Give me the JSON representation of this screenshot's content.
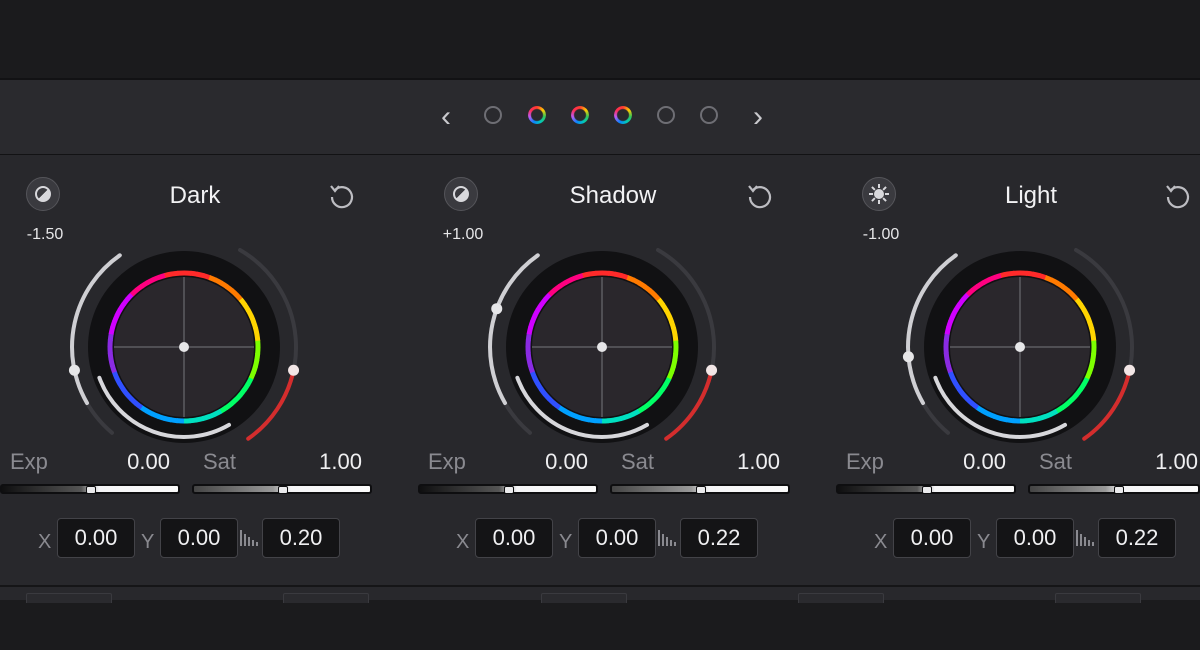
{
  "navigation": {
    "prev_icon": "chevron-left-icon",
    "next_icon": "chevron-right-icon",
    "pages": [
      {
        "state": "inactive"
      },
      {
        "state": "active"
      },
      {
        "state": "active"
      },
      {
        "state": "active"
      },
      {
        "state": "inactive"
      },
      {
        "state": "inactive"
      }
    ]
  },
  "wheels": [
    {
      "title": "Dark",
      "mode_icon": "half-contrast-icon",
      "mode_value": "-1.50",
      "exp_label": "Exp",
      "exp_value": "0.00",
      "sat_label": "Sat",
      "sat_value": "1.00",
      "x_label": "X",
      "x_value": "0.00",
      "y_label": "Y",
      "y_value": "0.00",
      "falloff_value": "0.20",
      "reset_icon": "reset-icon"
    },
    {
      "title": "Shadow",
      "mode_icon": "half-contrast-icon",
      "mode_value": "+1.00",
      "exp_label": "Exp",
      "exp_value": "0.00",
      "sat_label": "Sat",
      "sat_value": "1.00",
      "x_label": "X",
      "x_value": "0.00",
      "y_label": "Y",
      "y_value": "0.00",
      "falloff_value": "0.22",
      "reset_icon": "reset-icon"
    },
    {
      "title": "Light",
      "mode_icon": "sun-icon",
      "mode_value": "-1.00",
      "exp_label": "Exp",
      "exp_value": "0.00",
      "sat_label": "Sat",
      "sat_value": "1.00",
      "x_label": "X",
      "x_value": "0.00",
      "y_label": "Y",
      "y_value": "0.00",
      "falloff_value": "0.22",
      "reset_icon": "reset-icon"
    }
  ],
  "colors": {
    "panel_bg": "#28282c",
    "field_bg": "#141416",
    "accent_red": "#e03a3a"
  }
}
